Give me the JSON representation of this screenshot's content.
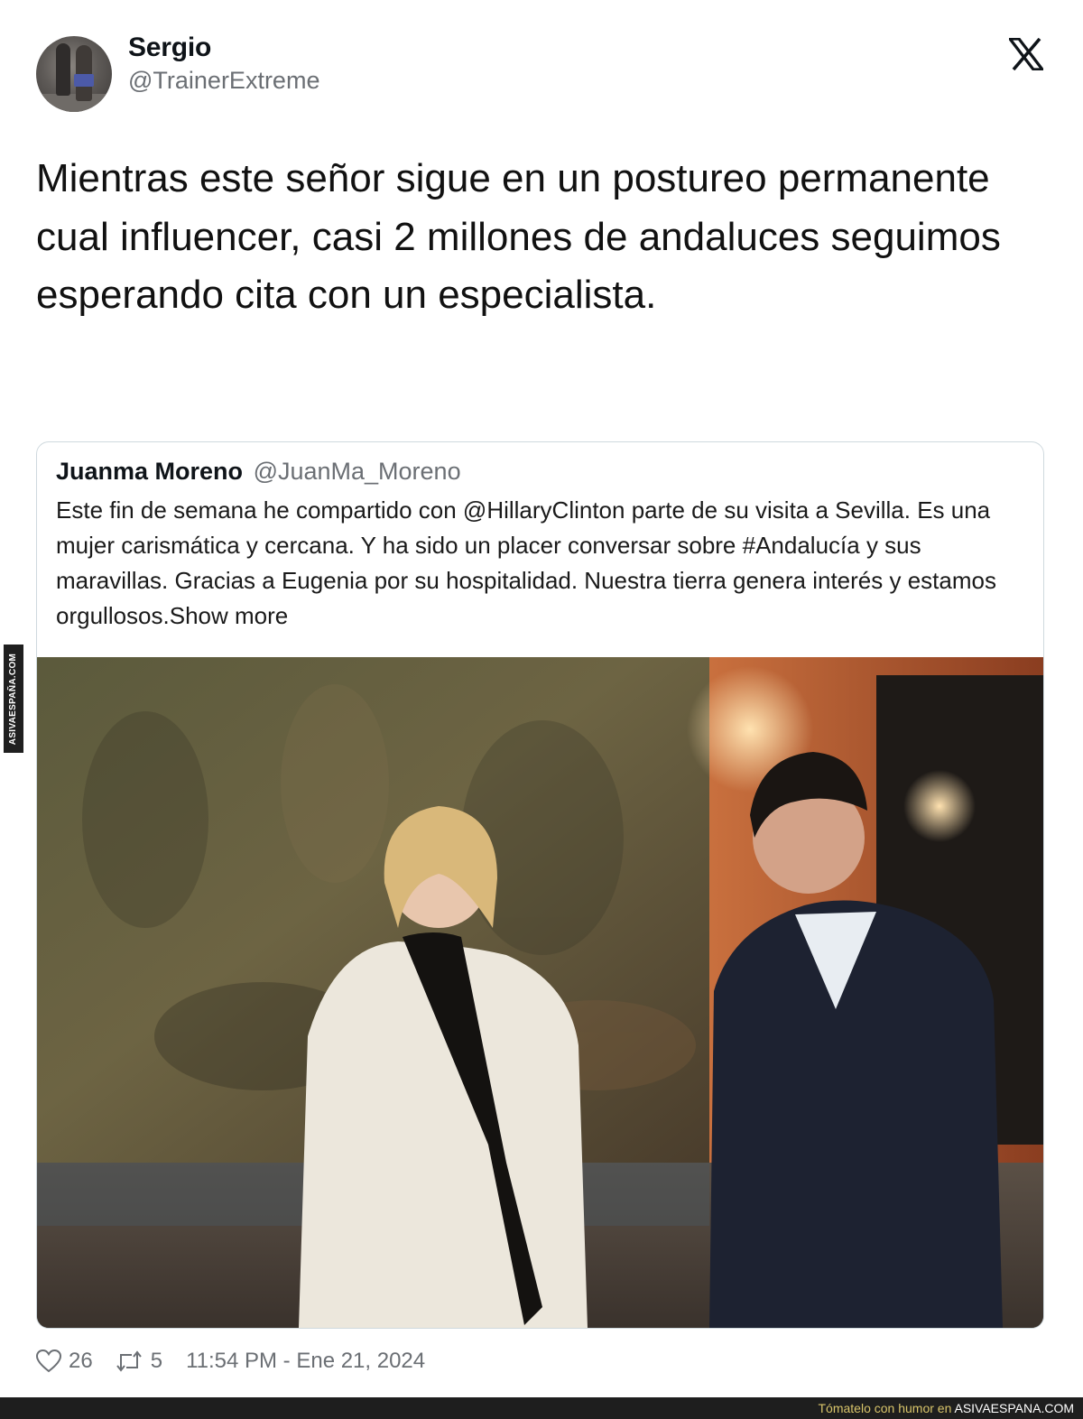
{
  "author": {
    "display_name": "Sergio",
    "handle": "@TrainerExtreme"
  },
  "platform_icon": "x-logo-icon",
  "tweet": {
    "text": "Mientras este señor sigue en un postureo permanente cual influencer, casi 2 millones de andaluces seguimos esperando cita con un especialista."
  },
  "quoted": {
    "name": "Juanma Moreno",
    "handle": "@JuanMa_Moreno",
    "text": "Este fin de semana he compartido con @HillaryClinton parte de su visita a Sevilla. Es una mujer carismática y cercana. Y ha sido un placer conversar sobre #Andalucía y sus maravillas. Gracias a Eugenia por su hospitalidad. Nuestra tierra genera interés y estamos orgullosos.",
    "show_more": "Show more"
  },
  "metrics": {
    "likes": "26",
    "retweets": "5",
    "timestamp": "11:54 PM - Ene 21, 2024"
  },
  "watermark": {
    "side": "ASIVAESPAÑA.COM",
    "bottom_tagline": "Tómatelo con humor en",
    "bottom_site": "ASIVAESPANA.COM"
  },
  "colors": {
    "text_primary": "#0f1419",
    "text_secondary": "#6b6f74",
    "border": "#cfd9de"
  }
}
